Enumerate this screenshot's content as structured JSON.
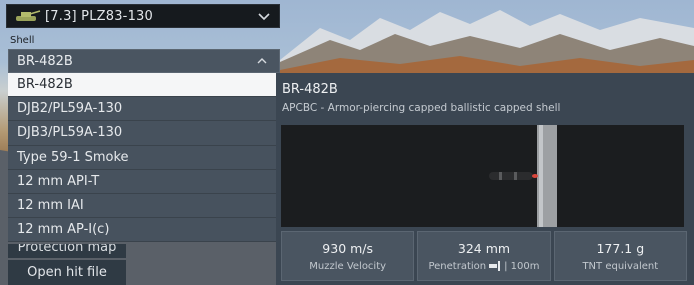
{
  "vehicle": {
    "name": "[7.3] PLZ83-130",
    "icon": "tank-icon"
  },
  "shell_section": {
    "label": "Shell",
    "selected": "BR-482B",
    "options": [
      "BR-482B",
      "DJB2/PL59A-130",
      "DJB3/PL59A-130",
      "Type 59-1 Smoke",
      "12 mm API-T",
      "12 mm IAI",
      "12 mm AP-I(c)"
    ]
  },
  "buttons": {
    "protection_map": "Protection map",
    "open_hit_file": "Open hit file"
  },
  "info": {
    "title": "BR-482B",
    "subtitle": "APCBC - Armor-piercing capped ballistic capped shell",
    "stats": [
      {
        "value": "930 m/s",
        "label": "Muzzle Velocity"
      },
      {
        "value": "324 mm",
        "label": "Penetration",
        "suffix": "| 100m"
      },
      {
        "value": "177.1 g",
        "label": "TNT equivalent"
      }
    ]
  },
  "colors": {
    "panel": "#3b4652",
    "item": "#47525e",
    "selected_item": "#f5f6f7"
  }
}
